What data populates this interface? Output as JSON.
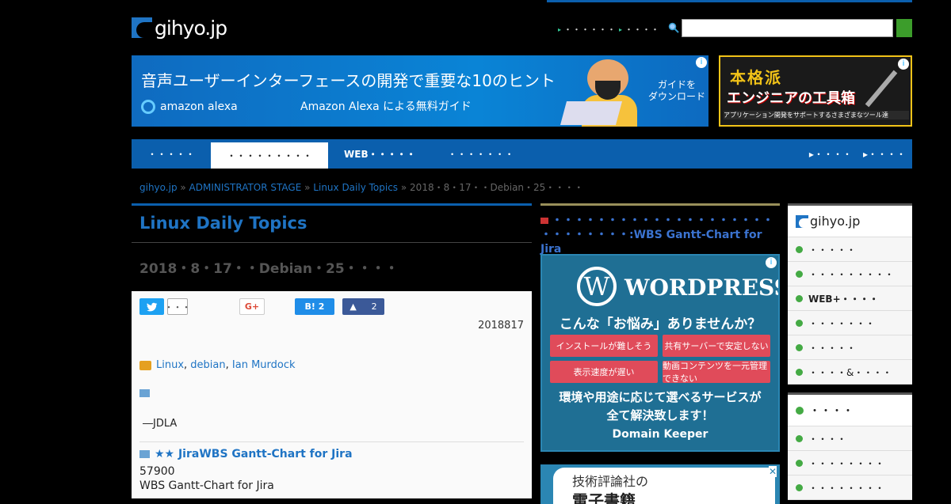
{
  "header": {
    "logo_text": "gihyo.jp",
    "links": [
      "・・・・・・",
      "・・・・"
    ],
    "search_placeholder": ""
  },
  "banner_alexa": {
    "headline": "音声ユーザーインターフェースの開発で重要な10のヒント",
    "brand": "amazon alexa",
    "subtitle": "Amazon Alexa による無料ガイド",
    "cta": "ガイドを\nダウンロード"
  },
  "banner_tools": {
    "line1": "本格派",
    "line2": "エンジニアの工具箱",
    "line3": "アプリケーション開発をサポートするさまざまなツール達"
  },
  "nav": {
    "items": [
      "・・・・・",
      "・・・・・・・・・",
      "WEB・・・・・",
      "・・・・・・・"
    ],
    "right": [
      "・・・・",
      "・・・・"
    ]
  },
  "breadcrumb": {
    "home": "gihyo.jp",
    "sep": " » ",
    "stage": "ADMINISTRATOR STAGE",
    "topic": "Linux Daily Topics",
    "current": "2018・8・17・・Debian・25・・・・"
  },
  "article": {
    "section": "Linux Daily Topics",
    "title": "2018・8・17・・Debian・25・・・・",
    "twitter_count": "・・・",
    "gplus": "G+",
    "hatena": "B! 2",
    "fb_count": "2",
    "date": "2018817",
    "tags": [
      "Linux",
      "debian",
      "Ian Murdock"
    ],
    "jdla": "―JDLA",
    "rec_title": "★★ JiraWBS Gantt-Chart for Jira",
    "rec_num": "57900",
    "rec_name": "WBS Gantt-Chart for Jira"
  },
  "mid": {
    "promo_line1": "・・・・・・・・・・・・・・・・・・・・",
    "promo_line2": "・・・・・・・・:WBS Gantt-Chart for Jira",
    "wp_logo": "W",
    "wp_text": "WORDPRESS",
    "wp_question": "こんな「お悩み」ありませんか？",
    "wp_buttons": [
      "インストールが難しそう",
      "共有サーバーで安定しない",
      "表示速度が遅い",
      "動画コンテンツを一元管理できない"
    ],
    "wp_solution": "環境や用途に応じて選べるサービスが\n全て解決致します！",
    "wp_brand": "Domain Keeper",
    "gihyo_ad_line1": "技術評論社の",
    "gihyo_ad_line2": "電子書籍"
  },
  "sidebar": {
    "logo": "gihyo.jp",
    "items": [
      "・・・・・",
      "・・・・・・・・・",
      "WEB+・・・・",
      "・・・・・・・",
      "・・・・・",
      "・・・・&・・・・"
    ],
    "box2_title": "・・・・",
    "box2_items": [
      "・・・・",
      "・・・・・・・・",
      "・・・・・・・・"
    ]
  }
}
